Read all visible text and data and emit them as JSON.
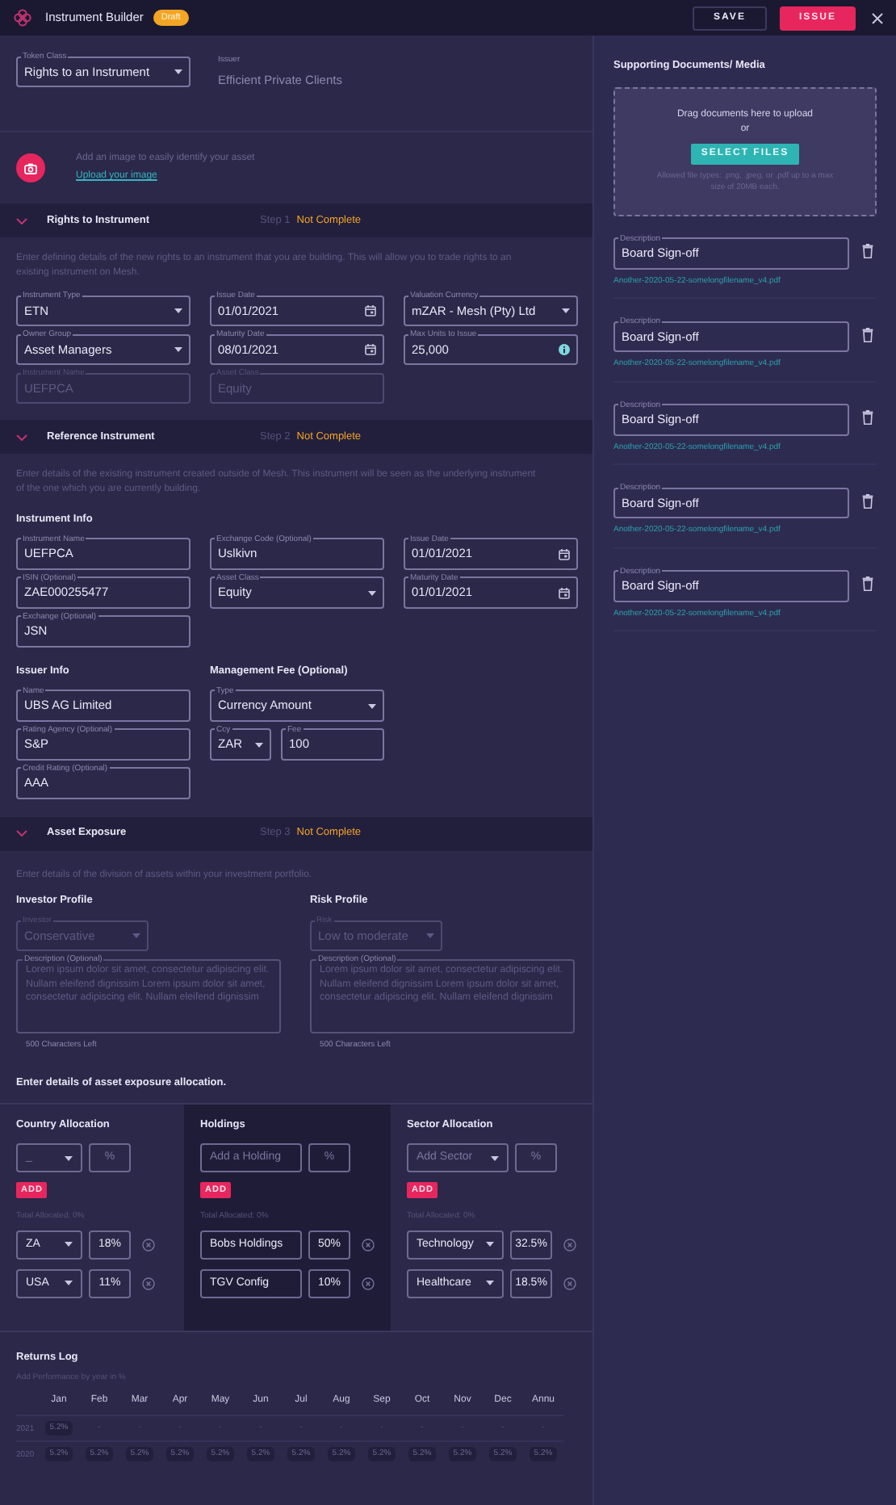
{
  "header": {
    "title": "Instrument Builder",
    "badge": "Draft",
    "save": "SAVE",
    "issue": "ISSUE"
  },
  "token": {
    "field": {
      "label": "Token Class",
      "value": "Rights to an Instrument",
      "kind": "select",
      "disabled": false
    },
    "issuer_label": "Issuer",
    "issuer_value": "Efficient Private Clients"
  },
  "image_upload": {
    "text": "Add an image to easily identify your asset",
    "link": "Upload your image"
  },
  "rights_section": {
    "header": {
      "title": "Rights to Instrument",
      "step": "Step 1",
      "status": "Not Complete",
      "expanded": true
    },
    "description": "Enter defining details of the new rights to an instrument that you are building. This will allow you to trade rights to an existing instrument on Mesh.",
    "fields": [
      {
        "label": "Instrument Type",
        "value": "ETN",
        "kind": "select",
        "disabled": false
      },
      {
        "label": "Issue Date",
        "value": "01/01/2021",
        "kind": "date",
        "disabled": false
      },
      {
        "label": "Valuation Currency",
        "value": "mZAR - Mesh (Pty) Ltd",
        "kind": "select",
        "disabled": false
      },
      {
        "label": "Owner Group",
        "value": "Asset Managers",
        "kind": "select",
        "disabled": false
      },
      {
        "label": "Maturity Date",
        "value": "08/01/2021",
        "kind": "date",
        "disabled": false
      },
      {
        "label": "Max Units to Issue",
        "value": "25,000",
        "kind": "info",
        "disabled": false
      },
      {
        "label": "Instrument Name",
        "value": "UEFPCA",
        "kind": "text",
        "disabled": true
      },
      {
        "label": "Asset Class",
        "value": "Equity",
        "kind": "text",
        "disabled": true
      }
    ]
  },
  "reference_section": {
    "header": {
      "title": "Reference Instrument",
      "step": "Step 2",
      "status": "Not Complete",
      "expanded": true
    },
    "description": "Enter details of the existing instrument created outside of Mesh. This instrument will be seen as the underlying instrument of the one which you are currently building.",
    "instrument_info": {
      "title": "Instrument Info",
      "fields": [
        {
          "label": "Instrument Name",
          "value": "UEFPCA",
          "kind": "text",
          "disabled": false
        },
        {
          "label": "Exchange Code (Optional)",
          "value": "Uslkivn",
          "kind": "text",
          "disabled": false
        },
        {
          "label": "Issue Date",
          "value": "01/01/2021",
          "kind": "date",
          "disabled": false
        },
        {
          "label": "ISIN (Optional)",
          "value": "ZAE000255477",
          "kind": "text",
          "disabled": false
        },
        {
          "label": "Asset Class",
          "value": "Equity",
          "kind": "select",
          "disabled": false
        },
        {
          "label": "Maturity Date",
          "value": "01/01/2021",
          "kind": "date",
          "disabled": false
        },
        {
          "label": "Exchange (Optional)",
          "value": "JSN",
          "kind": "text",
          "disabled": false
        }
      ]
    },
    "issuer_info": {
      "title": "Issuer Info",
      "fields": [
        {
          "label": "Name",
          "value": "UBS AG Limited",
          "kind": "text",
          "disabled": false
        },
        {
          "label": "Rating Agency (Optional)",
          "value": "S&P",
          "kind": "text",
          "disabled": false
        },
        {
          "label": "Credit Rating (Optional)",
          "value": "AAA",
          "kind": "text",
          "disabled": false
        }
      ]
    },
    "management_fee": {
      "title": "Management Fee (Optional)",
      "type": {
        "label": "Type",
        "value": "Currency Amount",
        "kind": "select",
        "disabled": false
      },
      "ccy": {
        "label": "Ccy",
        "value": "ZAR",
        "kind": "select",
        "disabled": false
      },
      "fee": {
        "label": "Fee",
        "value": "100",
        "kind": "text",
        "disabled": false
      }
    }
  },
  "exposure_section": {
    "header": {
      "title": "Asset Exposure",
      "step": "Step 3",
      "status": "Not Complete",
      "expanded": true
    },
    "description": "Enter details of the division of assets within your investment portfolio.",
    "profiles": [
      {
        "title": "Investor Profile",
        "select": {
          "label": "Investor",
          "value": "Conservative",
          "kind": "select",
          "disabled": true
        },
        "description": {
          "label": "Description (Optional)",
          "value": "Lorem ipsum dolor sit amet, consectetur adipiscing elit. Nullam eleifend dignissim Lorem ipsum dolor sit amet, consectetur adipiscing elit. Nullam eleifend dignissim"
        },
        "counter": "500 Characters Left"
      },
      {
        "title": "Risk Profile",
        "select": {
          "label": "Risk",
          "value": "Low to moderate",
          "kind": "select",
          "disabled": true
        },
        "description": {
          "label": "Description (Optional)",
          "value": "Lorem ipsum dolor sit amet, consectetur adipiscing elit. Nullam eleifend dignissim Lorem ipsum dolor sit amet, consectetur adipiscing elit. Nullam eleifend dignissim"
        },
        "counter": "500 Characters Left"
      }
    ],
    "allocation_prompt": "Enter details of asset exposure allocation.",
    "allocations": [
      {
        "title": "Country Allocation",
        "selected": false,
        "input": {
          "value": "_",
          "kind": "select"
        },
        "percent_placeholder": "%",
        "add": "ADD",
        "total": "Total Allocated: 0%",
        "rows": [
          {
            "name": "ZA",
            "kind": "select",
            "percent": "18%"
          },
          {
            "name": "USA",
            "kind": "select",
            "percent": "11%"
          }
        ]
      },
      {
        "title": "Holdings",
        "selected": true,
        "input": {
          "placeholder": "Add a Holding",
          "kind": "text"
        },
        "percent_placeholder": "%",
        "add": "ADD",
        "total": "Total Allocated: 0%",
        "rows": [
          {
            "name": "Bobs Holdings",
            "kind": "text",
            "percent": "50%"
          },
          {
            "name": "TGV Config",
            "kind": "text",
            "percent": "10%"
          }
        ]
      },
      {
        "title": "Sector Allocation",
        "selected": false,
        "input": {
          "placeholder": "Add Sector",
          "kind": "select"
        },
        "percent_placeholder": "%",
        "add": "ADD",
        "total": "Total Allocated: 0%",
        "rows": [
          {
            "name": "Technology",
            "kind": "select",
            "percent": "32.5%"
          },
          {
            "name": "Healthcare",
            "kind": "select",
            "percent": "18.5%"
          }
        ]
      }
    ]
  },
  "returns_log": {
    "title": "Returns Log",
    "subtitle": "Add Performance by year in %",
    "columns": [
      "Jan",
      "Feb",
      "Mar",
      "Apr",
      "May",
      "Jun",
      "Jul",
      "Aug",
      "Sep",
      "Oct",
      "Nov",
      "Dec",
      "Annu"
    ],
    "rows": [
      {
        "year": "2021",
        "values": [
          "5.2%",
          "-",
          "-",
          "-",
          "-",
          "-",
          "-",
          "-",
          "-",
          "-",
          "-",
          "-",
          "-"
        ]
      },
      {
        "year": "2020",
        "values": [
          "5.2%",
          "5.2%",
          "5.2%",
          "5.2%",
          "5.2%",
          "5.2%",
          "5.2%",
          "5.2%",
          "5.2%",
          "5.2%",
          "5.2%",
          "5.2%",
          "5.2%"
        ]
      }
    ]
  },
  "documents": {
    "title": "Supporting Documents/ Media",
    "dropzone": {
      "text": "Drag documents here to upload",
      "or": "or",
      "button": "SELECT FILES",
      "note": "Allowed file types: .png, .jpeg, or .pdf up to a max size of 20MB each."
    },
    "items": [
      {
        "label": "Description",
        "value": "Board Sign-off",
        "file": "Another-2020-05-22-somelongfilename_v4.pdf"
      },
      {
        "label": "Description",
        "value": "Board Sign-off",
        "file": "Another-2020-05-22-somelongfilename_v4.pdf"
      },
      {
        "label": "Description",
        "value": "Board Sign-off",
        "file": "Another-2020-05-22-somelongfilename_v4.pdf"
      },
      {
        "label": "Description",
        "value": "Board Sign-off",
        "file": "Another-2020-05-22-somelongfilename_v4.pdf"
      },
      {
        "label": "Description",
        "value": "Board Sign-off",
        "file": "Another-2020-05-22-somelongfilename_v4.pdf"
      }
    ]
  }
}
